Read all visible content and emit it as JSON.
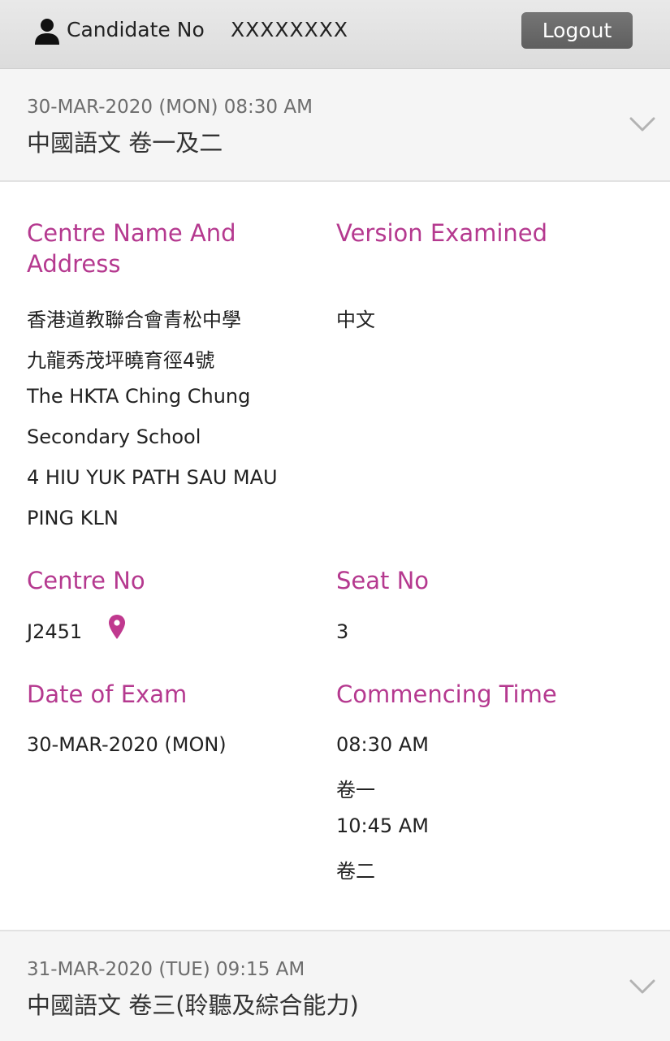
{
  "header": {
    "candidate_label": "Candidate No",
    "candidate_value": "XXXXXXXX",
    "logout_label": "Logout"
  },
  "exams": [
    {
      "datetime": "30-MAR-2020 (MON) 08:30 AM",
      "title": "中國語文 卷一及二",
      "expanded": true
    },
    {
      "datetime": "31-MAR-2020 (TUE) 09:15 AM",
      "title": "中國語文 卷三(聆聽及綜合能力)",
      "expanded": false
    }
  ],
  "details": {
    "centre_name_label": "Centre Name And Address",
    "centre_name_label_lines": [
      "Centre Name And",
      "Address"
    ],
    "version_label": "Version Examined",
    "version_value": "中文",
    "address_lines": [
      "香港道教聯合會青松中學",
      "九龍秀茂坪曉育徑4號",
      "The HKTA Ching Chung",
      "Secondary School",
      "4 HIU YUK PATH SAU MAU",
      "PING KLN"
    ],
    "centre_no_label": "Centre No",
    "centre_no_value": "J2451",
    "seat_no_label": "Seat No",
    "seat_no_value": "3",
    "date_label": "Date of Exam",
    "date_value": "30-MAR-2020 (MON)",
    "time_label": "Commencing Time",
    "time_lines": [
      "08:30 AM",
      "卷一",
      "10:45 AM",
      "卷二"
    ]
  },
  "icons": {
    "user": "user-icon",
    "chevron": "chevron-down-icon",
    "pin": "map-pin-icon"
  },
  "colors": {
    "label_accent": "#b5398f",
    "logout_bg": "#666666",
    "topbar_bg": "#e0e0e0"
  }
}
